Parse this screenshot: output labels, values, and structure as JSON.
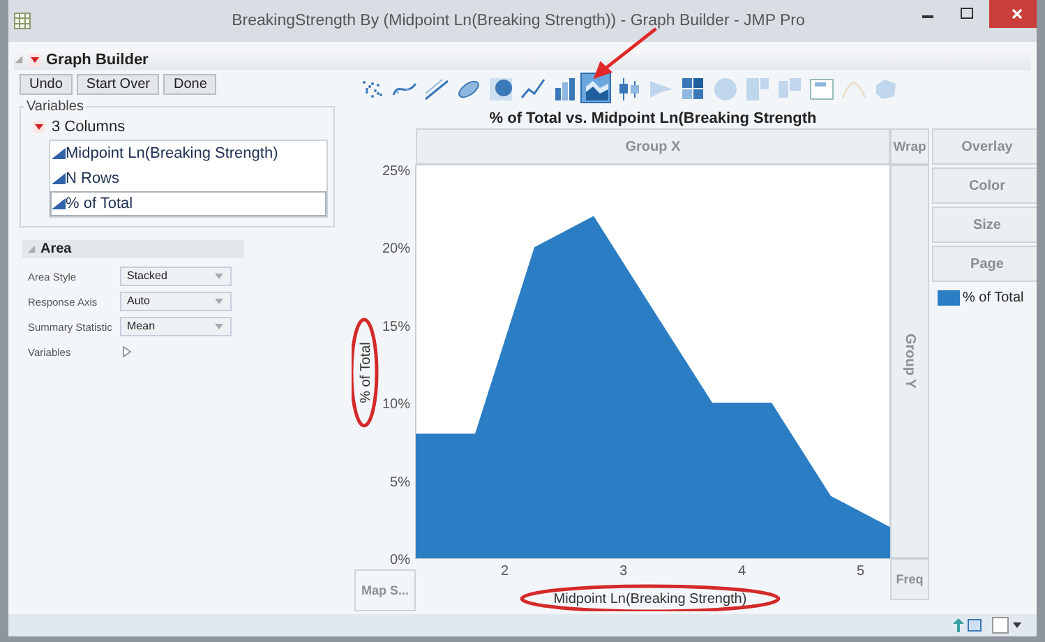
{
  "window": {
    "title": "BreakingStrength By (Midpoint Ln(Breaking Strength)) - Graph Builder - JMP Pro"
  },
  "report": {
    "title": "Graph Builder",
    "expanded": true
  },
  "buttons": [
    "Undo",
    "Start Over",
    "Done"
  ],
  "variables": {
    "label": "Variables",
    "group": "3 Columns",
    "expanded": true,
    "columns": [
      {
        "name": "Midpoint Ln(Breaking Strength)",
        "selected": false
      },
      {
        "name": "N Rows",
        "selected": false
      },
      {
        "name": "% of Total",
        "selected": true
      }
    ]
  },
  "area": {
    "title": "Area",
    "settings": [
      {
        "kind": "dropdown",
        "label": "Area Style",
        "value": "Stacked"
      },
      {
        "kind": "dropdown",
        "label": "Response Axis",
        "value": "Auto"
      },
      {
        "kind": "dropdown",
        "label": "Summary Statistic",
        "value": "Mean"
      },
      {
        "kind": "disclosure",
        "label": "Variables"
      }
    ]
  },
  "toolbar": [
    {
      "kind": "points",
      "selected": false,
      "disabled": false
    },
    {
      "kind": "smoother",
      "selected": false,
      "disabled": false
    },
    {
      "kind": "fit",
      "selected": false,
      "disabled": false
    },
    {
      "kind": "ellipse",
      "selected": false,
      "disabled": false
    },
    {
      "kind": "contour",
      "selected": false,
      "disabled": false
    },
    {
      "kind": "line",
      "selected": false,
      "disabled": false
    },
    {
      "kind": "bar",
      "selected": false,
      "disabled": false
    },
    {
      "kind": "area",
      "selected": true,
      "disabled": false
    },
    {
      "kind": "box",
      "selected": false,
      "disabled": false
    },
    {
      "kind": "histogram",
      "selected": false,
      "disabled": true
    },
    {
      "kind": "heatmap",
      "selected": false,
      "disabled": false
    },
    {
      "kind": "pie",
      "selected": false,
      "disabled": true
    },
    {
      "kind": "treemap",
      "selected": false,
      "disabled": true
    },
    {
      "kind": "mosaic",
      "selected": false,
      "disabled": true
    },
    {
      "kind": "caption",
      "selected": false,
      "disabled": false
    },
    {
      "kind": "formula",
      "selected": false,
      "disabled": true
    },
    {
      "kind": "map",
      "selected": false,
      "disabled": true
    }
  ],
  "graph": {
    "title": "% of Total vs. Midpoint Ln(Breaking Strength",
    "zones": {
      "group_x": "Group X",
      "wrap": "Wrap",
      "group_y": "Group Y",
      "map_shape": "Map S...",
      "freq": "Freq"
    },
    "side_zones": [
      "Overlay",
      "Color",
      "Size",
      "Page"
    ],
    "chart_data": {
      "type": "area",
      "xlabel": "Midpoint Ln(Breaking Strength)",
      "ylabel": "% of Total",
      "x": [
        1.25,
        1.75,
        2.25,
        2.75,
        3.25,
        3.75,
        4.25,
        4.4,
        4.75,
        5.25
      ],
      "series": [
        {
          "name": "% of Total",
          "color": "#2b7ec4",
          "values": [
            8,
            8,
            20,
            22,
            16,
            10,
            10,
            8.2,
            4,
            2
          ]
        }
      ],
      "xlim": [
        1.25,
        5.25
      ],
      "ylim": [
        0,
        25.3
      ],
      "xticks": [
        2,
        3,
        4,
        5
      ],
      "yticks": [
        {
          "value": 0,
          "label": "0%"
        },
        {
          "value": 5,
          "label": "5%"
        },
        {
          "value": 10,
          "label": "10%"
        },
        {
          "value": 15,
          "label": "15%"
        },
        {
          "value": 20,
          "label": "20%"
        },
        {
          "value": 25,
          "label": "25%"
        }
      ]
    }
  }
}
